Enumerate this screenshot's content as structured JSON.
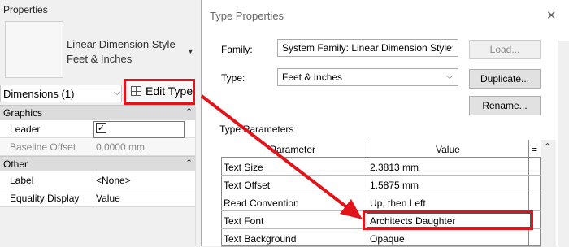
{
  "properties": {
    "title": "Properties",
    "type_selector": {
      "line1": "Linear Dimension Style",
      "line2": "Feet & Inches"
    },
    "filter_label": "Dimensions (1)",
    "edit_type_label": "Edit Type",
    "sections": [
      {
        "label": "Graphics",
        "rows": [
          {
            "name": "Leader",
            "value_checked": true
          },
          {
            "name": "Baseline Offset",
            "value": "0.0000 mm"
          }
        ]
      },
      {
        "label": "Other",
        "rows": [
          {
            "name": "Label",
            "value": "<None>"
          },
          {
            "name": "Equality Display",
            "value": "Value"
          }
        ]
      }
    ]
  },
  "dialog": {
    "title": "Type Properties",
    "family_label": "Family:",
    "family_value": "System Family: Linear Dimension Style",
    "type_label": "Type:",
    "type_value": "Feet & Inches",
    "load_button": "Load...",
    "duplicate_button": "Duplicate...",
    "rename_button": "Rename...",
    "type_parameters_label": "Type Parameters",
    "columns": {
      "parameter": "Parameter",
      "value": "Value",
      "eq": "="
    },
    "rows": [
      {
        "parameter": "Text Size",
        "value": "2.3813 mm"
      },
      {
        "parameter": "Text Offset",
        "value": "1.5875 mm"
      },
      {
        "parameter": "Read Convention",
        "value": "Up, then Left"
      },
      {
        "parameter": "Text Font",
        "value": "Architects Daughter"
      },
      {
        "parameter": "Text Background",
        "value": "Opaque"
      }
    ]
  },
  "annotation": {
    "arrow_color": "#e0141a",
    "highlight_color": "#e0141a"
  }
}
